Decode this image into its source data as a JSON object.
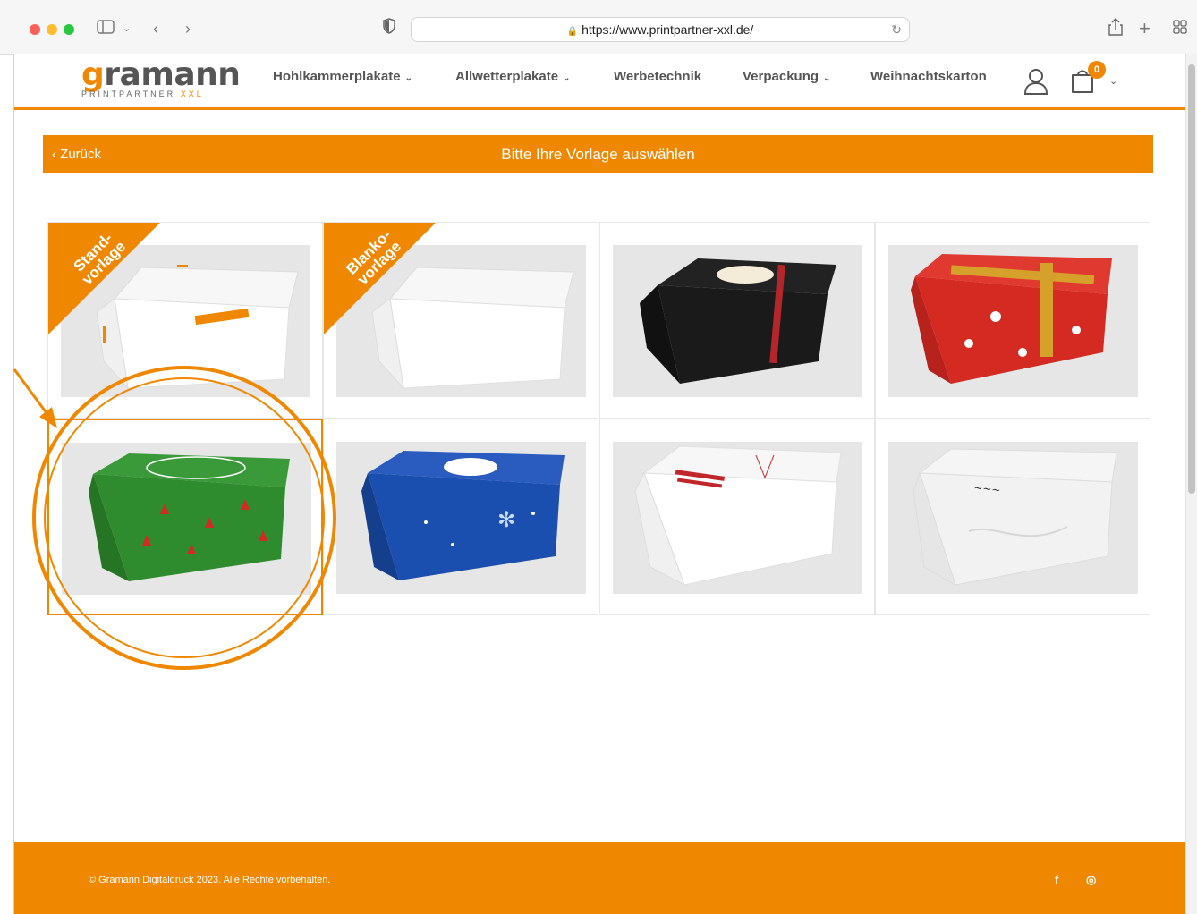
{
  "browser": {
    "url": "https://www.printpartner-xxl.de/"
  },
  "logo": {
    "main_g": "g",
    "main_rest": "ramann",
    "sub": "PRINTPARTNER",
    "sub_accent": "XXL"
  },
  "nav": {
    "items": [
      {
        "label": "Hohlkammerplakate",
        "has_dropdown": true
      },
      {
        "label": "Allwetterplakate",
        "has_dropdown": true
      },
      {
        "label": "Werbetechnik",
        "has_dropdown": false
      },
      {
        "label": "Verpackung",
        "has_dropdown": true
      },
      {
        "label": "Weihnachtskarton",
        "has_dropdown": false
      }
    ],
    "cart_count": "0"
  },
  "title_bar": {
    "back_label": "Zurück",
    "title": "Bitte Ihre Vorlage auswählen"
  },
  "templates": [
    {
      "ribbon_line1": "Stand-",
      "ribbon_line2": "vorlage",
      "style": "white box with orange print",
      "box_color": "#ffffff",
      "ribbon": true
    },
    {
      "ribbon_line1": "Blanko-",
      "ribbon_line2": "vorlage",
      "style": "blank white box",
      "box_color": "#ffffff",
      "ribbon": true
    },
    {
      "style": "black box with red ribbon",
      "box_color": "#1a1a1a",
      "ribbon": false
    },
    {
      "style": "red box with snowmen and gold ribbon",
      "box_color": "#d42a22",
      "ribbon": false
    },
    {
      "style": "green box with red trees",
      "box_color": "#2e8b2e",
      "ribbon": false,
      "selected": true
    },
    {
      "style": "blue box with snowflakes",
      "box_color": "#1a4fb0",
      "ribbon": false
    },
    {
      "style": "white box with red text",
      "box_color": "#ffffff",
      "ribbon": false
    },
    {
      "style": "white marble box",
      "box_color": "#f2f2f2",
      "ribbon": false
    }
  ],
  "footer": {
    "copyright": "© Gramann Digitaldruck 2023. Alle Rechte vorbehalten.",
    "facebook": "f",
    "instagram": "◎"
  },
  "colors": {
    "accent": "#ef8700",
    "text": "#555555",
    "tile_bg": "#e6e6e6"
  }
}
